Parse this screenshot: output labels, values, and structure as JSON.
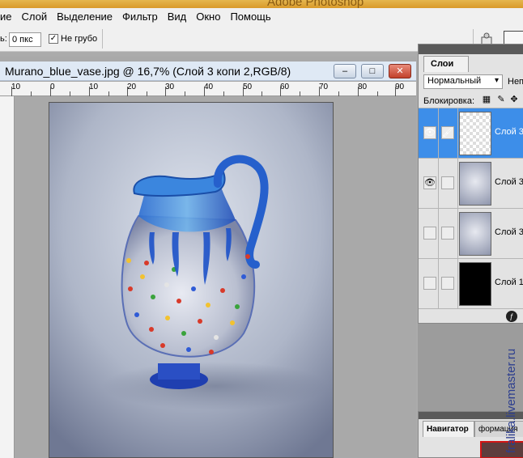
{
  "app": {
    "title": "Adobe Photoshop"
  },
  "menu": {
    "items": [
      "ие",
      "Слой",
      "Выделение",
      "Фильтр",
      "Вид",
      "Окно",
      "Помощь"
    ]
  },
  "options": {
    "label": "ь:",
    "feather_value": "0 пкс",
    "antialias_checked": "✓",
    "antialias_label": "Не грубо"
  },
  "document": {
    "title": "Murano_blue_vase.jpg @ 16,7% (Слой 3 копи 2,RGB/8)",
    "minimize": "–",
    "maximize": "□",
    "close": "✕",
    "ruler_labels": [
      "10",
      "0",
      "10",
      "20",
      "30",
      "40",
      "50",
      "60",
      "70",
      "80",
      "90"
    ]
  },
  "layers_panel": {
    "tab_label": "Слои",
    "blend_mode": "Нормальный",
    "opacity_label": "Непр",
    "lock_label": "Блокировка:",
    "layers": [
      {
        "name": "Слой 3",
        "visible": true,
        "selected": true,
        "brush": "🖌"
      },
      {
        "name": "Слой 3",
        "visible": true,
        "selected": false
      },
      {
        "name": "Слой 3",
        "visible": false,
        "selected": false
      },
      {
        "name": "Слой 1",
        "visible": false,
        "selected": false
      }
    ]
  },
  "navigator": {
    "tab_active": "Навигатор",
    "tab_inactive": "формация"
  },
  "watermark": {
    "text": "fralika.livemaster.ru"
  },
  "colors": {
    "selected_layer": "#3d8ee9",
    "doc_title_bg": "#dfe9f5",
    "close_btn": "#c2412b"
  }
}
